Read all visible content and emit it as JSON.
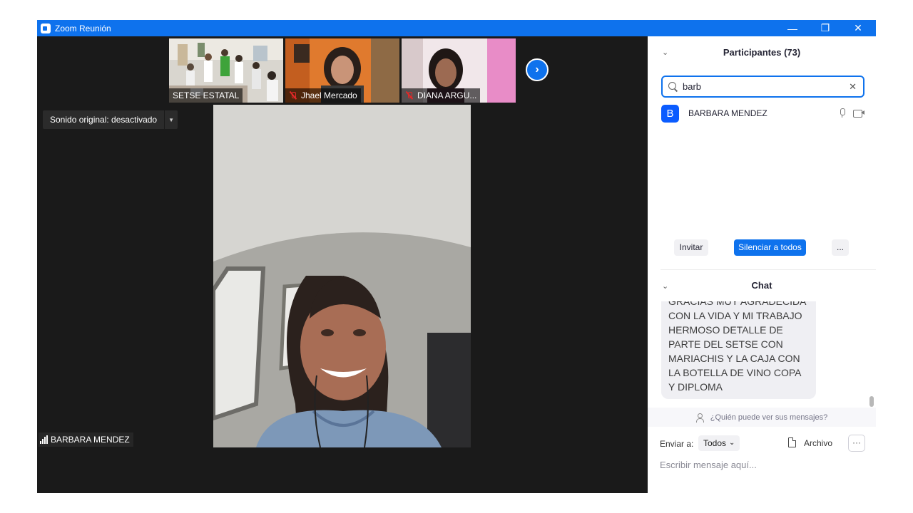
{
  "window": {
    "title": "Zoom Reunión",
    "controls": {
      "minimize": "—",
      "restore": "❐",
      "close": "✕"
    }
  },
  "thumbnails": [
    {
      "name": "SETSE ESTATAL",
      "muted": false
    },
    {
      "name": "Jhael Mercado",
      "muted": true
    },
    {
      "name": "DIANA ARGU...",
      "muted": true
    }
  ],
  "next_arrow": "›",
  "original_sound": {
    "label": "Sonido original: desactivado",
    "caret": "▼"
  },
  "active_speaker": {
    "name": "BARBARA MENDEZ"
  },
  "participants": {
    "title": "Participantes (73)",
    "collapse_icon": "⌄",
    "search_value": "barb",
    "clear_icon": "✕",
    "list": [
      {
        "initial": "B",
        "name": "BARBARA MENDEZ"
      }
    ],
    "buttons": {
      "invite": "Invitar",
      "mute_all": "Silenciar a todos",
      "more": "..."
    }
  },
  "chat": {
    "title": "Chat",
    "collapse_icon": "⌄",
    "last_message": "GRACIAS MUY AGRADECIDA CON LA VIDA Y MI TRABAJO HERMOSO DETALLE DE PARTE DEL SETSE CON MARIACHIS Y LA CAJA CON LA BOTELLA DE VINO COPA Y DIPLOMA",
    "who_can_see": "¿Quién puede ver sus mensajes?",
    "send_to_label": "Enviar a:",
    "send_to_value": "Todos",
    "send_to_caret": "⌄",
    "file_label": "Archivo",
    "more": "···",
    "input_placeholder": "Escribir mensaje aquí..."
  },
  "colors": {
    "accent": "#0e72ed",
    "stage": "#1a1a1a",
    "muted_red": "#e02828"
  }
}
